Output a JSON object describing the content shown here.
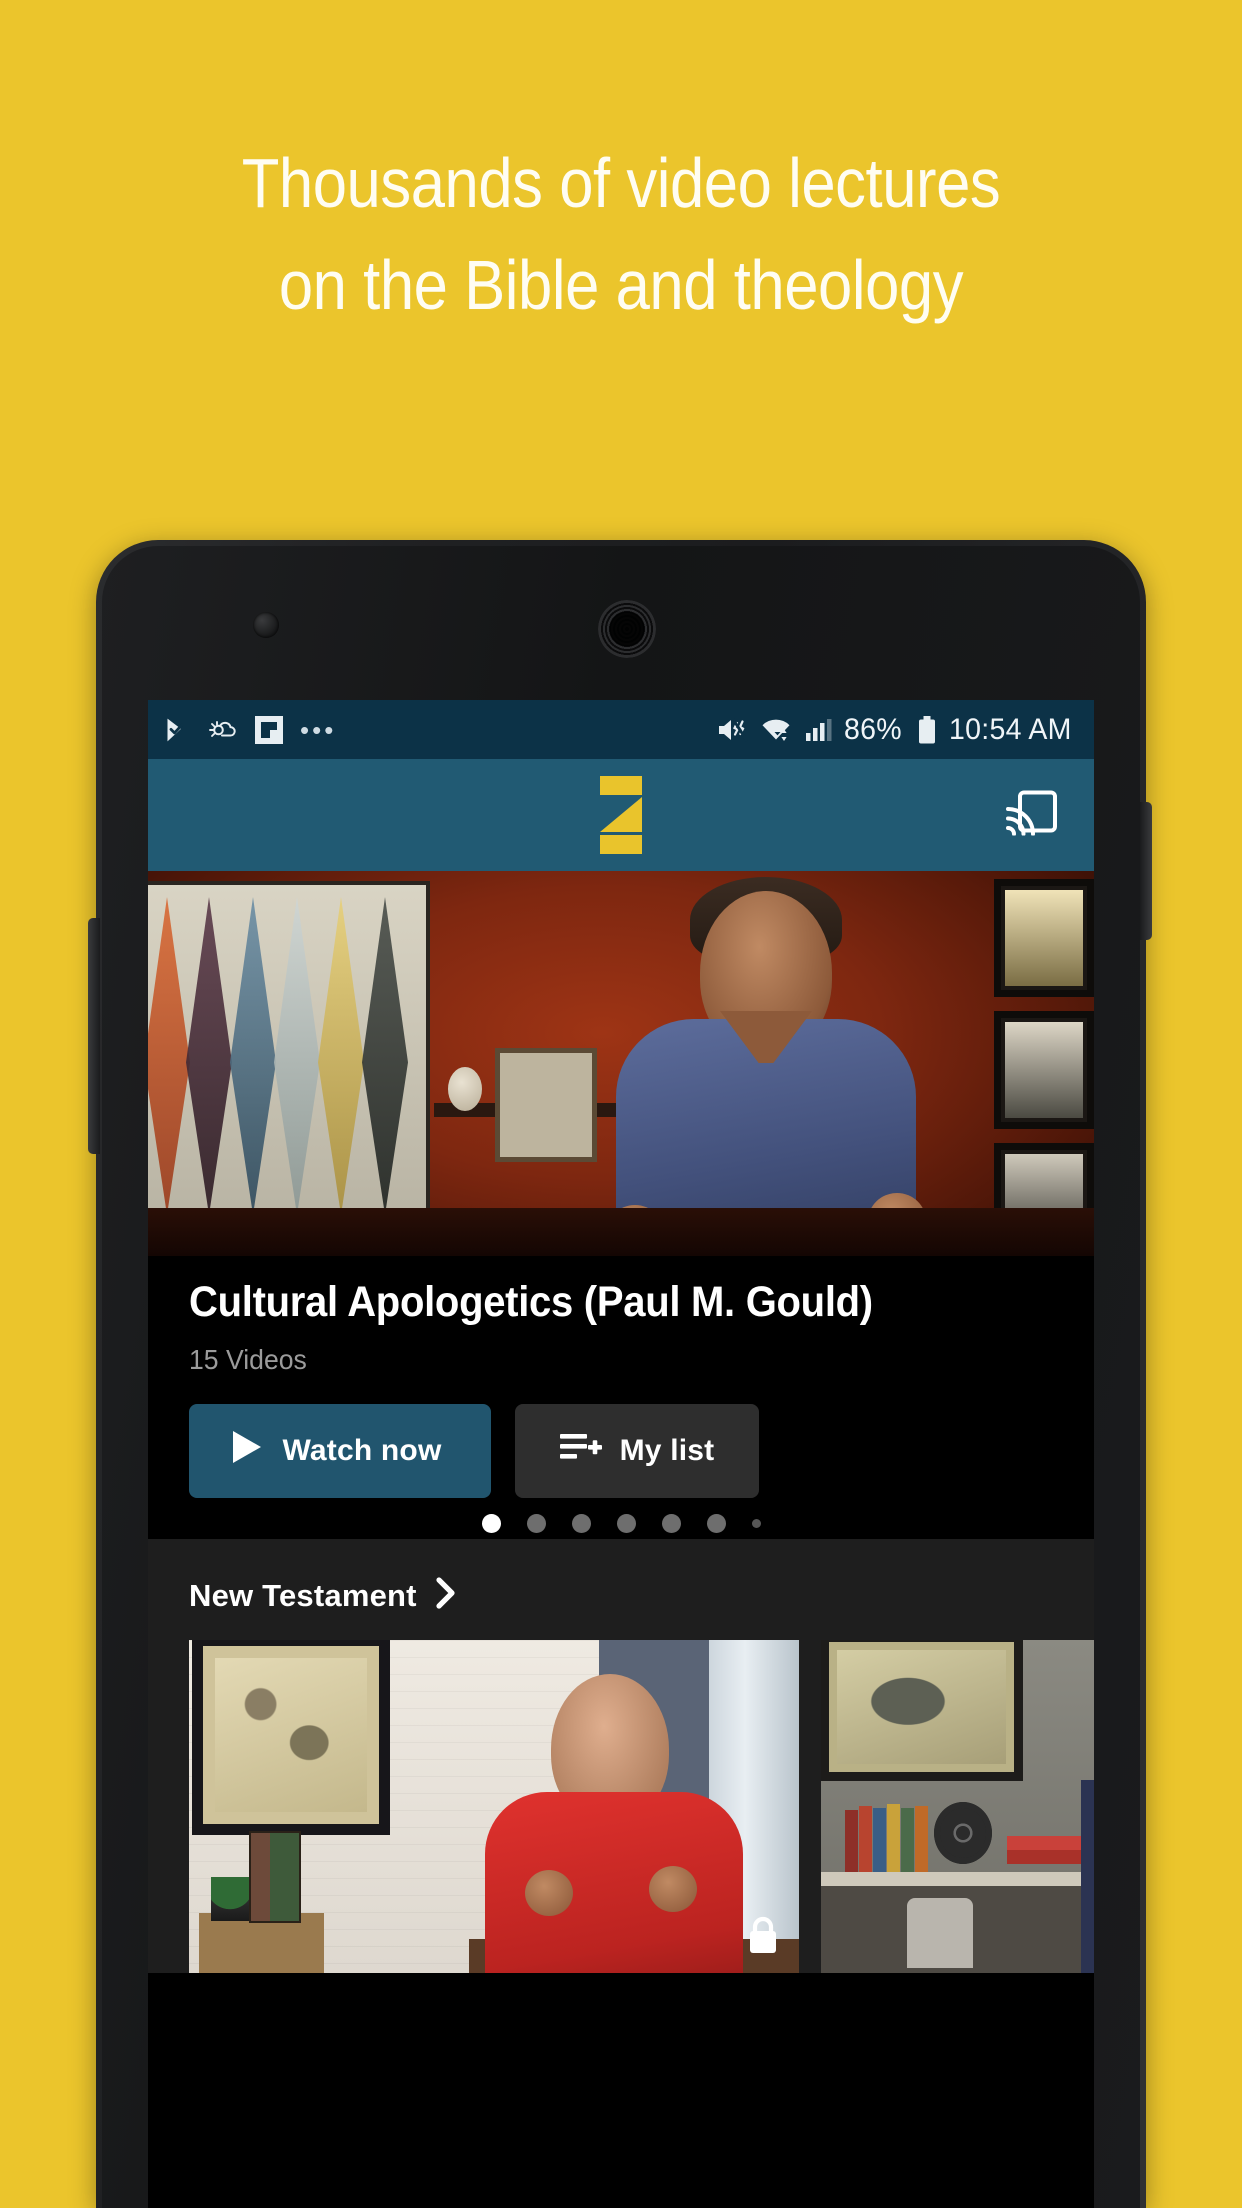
{
  "promo": {
    "background_color": "#EBC52C",
    "headline_line1": "Thousands of video lectures",
    "headline_line2": "on the Bible and theology"
  },
  "device": {
    "frame_color": "#1b1c1e",
    "camera_label": "front-camera",
    "speaker_label": "earpiece-speaker"
  },
  "status_bar": {
    "background_color": "#0C3247",
    "left_icons": [
      "play-update-icon",
      "weather-icon",
      "flipboard-icon"
    ],
    "overflow": "•••",
    "mute_icon": "volume-mute-icon",
    "wifi_icon": "wifi-icon",
    "signal_icon": "cellular-signal-icon",
    "battery_percent": "86%",
    "battery_icon": "battery-icon",
    "time": "10:54 AM"
  },
  "app_bar": {
    "background_color": "#215A73",
    "logo_name": "app-logo",
    "logo_color": "#E9C42C",
    "cast_icon": "chromecast-icon"
  },
  "hero": {
    "title": "Cultural Apologetics (Paul M. Gould)",
    "subtitle": "15 Videos",
    "watch_label": "Watch now",
    "watch_icon": "play-icon",
    "watch_color": "#21556E",
    "mylist_label": "My list",
    "mylist_icon": "playlist-add-icon",
    "mylist_color": "#2E2E2E",
    "dots": [
      {
        "state": "active"
      },
      {
        "state": "inactive"
      },
      {
        "state": "inactive"
      },
      {
        "state": "inactive"
      },
      {
        "state": "inactive"
      },
      {
        "state": "inactive"
      },
      {
        "state": "tiny"
      }
    ]
  },
  "rows": [
    {
      "title": "New Testament",
      "chevron_icon": "chevron-right-icon",
      "cards": [
        {
          "name": "card-new-testament-1",
          "locked": true,
          "lock_icon": "lock-icon"
        },
        {
          "name": "card-new-testament-2",
          "locked": false
        }
      ]
    }
  ]
}
